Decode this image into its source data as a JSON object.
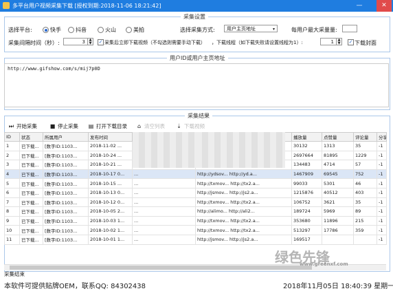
{
  "window": {
    "title": "多平台用户视频采集下载   [授权到期:2018-11-06 18:21:42]",
    "min_glyph": "—",
    "close_glyph": "✕"
  },
  "settings": {
    "section_title": "采集设置",
    "platform_label": "选择平台:",
    "platforms": [
      "快手",
      "抖音",
      "火山",
      "美拍"
    ],
    "selected_platform": "快手",
    "mode_label": "选择采集方式:",
    "mode_value": "用户主页地址",
    "max_label": "每用户最大采量量:",
    "max_value": "",
    "interval_label": "采集间隔时间（秒）:",
    "interval_value": "3",
    "auto_download_label": "采集后立即下载视频（不勾选则需要手动下载）",
    "threads_label": "，下载线程（如下载失败请设置线程为1）:",
    "threads_value": "1",
    "cover_label": "下载封面"
  },
  "url_input": {
    "section_title": "用户ID或用户主页地址",
    "value": "http://www.gifshow.com/s/mij7p0D"
  },
  "results": {
    "section_title": "采集结果",
    "toolbar": {
      "start": "开始采集",
      "stop": "停止采集",
      "open_dir": "打开下载目录",
      "clear": "清空列表",
      "export": "下载视频"
    },
    "columns": [
      "ID",
      "状态",
      "所属用户",
      "发布时间",
      "",
      "",
      "播放量",
      "点赞量",
      "评论量",
      "分享量"
    ],
    "rows": [
      {
        "id": "1",
        "status": "已下载...",
        "user": "[数字ID:1103...",
        "time": "2018-11-02 ...",
        "desc": "",
        "url": "",
        "plays": "30132",
        "likes": "1313",
        "comments": "35",
        "shares": "-1"
      },
      {
        "id": "2",
        "status": "已下载...",
        "user": "[数字ID:1103...",
        "time": "2018-10-24 ...",
        "desc": "",
        "url": "",
        "plays": "2697664",
        "likes": "81895",
        "comments": "1229",
        "shares": "-1"
      },
      {
        "id": "3",
        "status": "已下载...",
        "user": "[数字ID:1103...",
        "time": "2018-10-21 ...",
        "desc": "",
        "url": "",
        "plays": "134483",
        "likes": "4714",
        "comments": "57",
        "shares": "-1"
      },
      {
        "id": "4",
        "status": "已下载...",
        "user": "[数字ID:1103...",
        "time": "2018-10-17 0...",
        "desc": "...",
        "url": "http://ydsov...  http://yd.a...",
        "plays": "1467909",
        "likes": "69545",
        "comments": "752",
        "shares": "-1"
      },
      {
        "id": "5",
        "status": "已下载...",
        "user": "[数字ID:1103...",
        "time": "2018-10-15 ...",
        "desc": "...",
        "url": "http://txmov...  http://tx2.a...",
        "plays": "99033",
        "likes": "5301",
        "comments": "46",
        "shares": "-1"
      },
      {
        "id": "6",
        "status": "已下载...",
        "user": "[数字ID:1103...",
        "time": "2018-10-13 0...",
        "desc": "...",
        "url": "http://jsmov...  http://js2.a...",
        "plays": "1215876",
        "likes": "40512",
        "comments": "403",
        "shares": "-1"
      },
      {
        "id": "7",
        "status": "已下载...",
        "user": "[数字ID:1103...",
        "time": "2018-10-12 0...",
        "desc": "...",
        "url": "http://txmov...  http://tx2.a...",
        "plays": "106752",
        "likes": "3621",
        "comments": "35",
        "shares": "-1"
      },
      {
        "id": "8",
        "status": "已下载...",
        "user": "[数字ID:1103...",
        "time": "2018-10-05 2...",
        "desc": "...",
        "url": "http://alimo...  http://ali2...",
        "plays": "189724",
        "likes": "5969",
        "comments": "89",
        "shares": "-1"
      },
      {
        "id": "9",
        "status": "已下载...",
        "user": "[数字ID:1103...",
        "time": "2018-10-03 1...",
        "desc": "...",
        "url": "http://txmov...  http://tx2.a...",
        "plays": "353680",
        "likes": "11896",
        "comments": "215",
        "shares": "-1"
      },
      {
        "id": "10",
        "status": "已下载...",
        "user": "[数字ID:1103...",
        "time": "2018-10-02 1...",
        "desc": "...",
        "url": "http://txmov...  http://tx2.a...",
        "plays": "513297",
        "likes": "17786",
        "comments": "359",
        "shares": "-1"
      },
      {
        "id": "11",
        "status": "已下载...",
        "user": "[数字ID:1103...",
        "time": "2018-10-01 1...",
        "desc": "...",
        "url": "http://jsmov...  http://js2.a...",
        "plays": "169517",
        "likes": "",
        "comments": "",
        "shares": "-1"
      }
    ]
  },
  "status": {
    "text": "采集结束",
    "oem": "本软件可提供贴牌OEM，联系QQ:  84302438",
    "datetime": "2018年11月05日  18:40:39 星期一"
  },
  "watermark": {
    "main": "绿色先锋",
    "sub": "www.greenxf.com"
  }
}
